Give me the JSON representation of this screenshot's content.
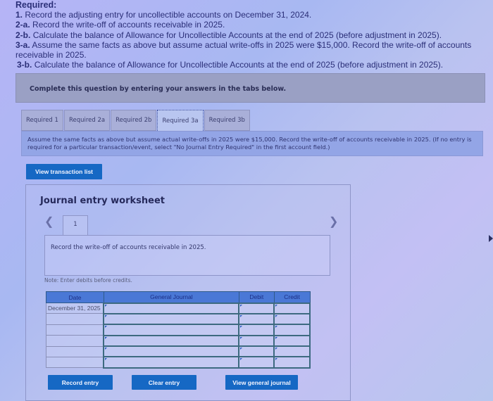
{
  "requirements": {
    "title": "Required:",
    "items": [
      {
        "label": "1.",
        "text": "Record the adjusting entry for uncollectible accounts on December 31, 2024."
      },
      {
        "label": "2-a.",
        "text": "Record the write-off of accounts receivable in 2025."
      },
      {
        "label": "2-b.",
        "text": "Calculate the balance of Allowance for Uncollectible Accounts at the end of 2025 (before adjustment in 2025)."
      },
      {
        "label": "3-a.",
        "text": "Assume the same facts as above but assume actual write-offs in 2025 were $15,000. Record the write-off of accounts receivable in 2025."
      },
      {
        "label": "3-b.",
        "text": "Calculate the balance of Allowance for Uncollectible Accounts at the end of 2025 (before adjustment in 2025)."
      }
    ]
  },
  "instruction": "Complete this question by entering your answers in the tabs below.",
  "tabs": [
    {
      "label": "Required 1",
      "active": false
    },
    {
      "label": "Required 2a",
      "active": false
    },
    {
      "label": "Required 2b",
      "active": false
    },
    {
      "label": "Required 3a",
      "active": true
    },
    {
      "label": "Required 3b",
      "active": false
    }
  ],
  "tab_panel_text": "Assume the same facts as above but assume actual write-offs in 2025 were $15,000. Record the write-off of accounts receivable in 2025. (If no entry is required for a particular transaction/event, select \"No Journal Entry Required\" in the first account field.)",
  "view_transaction_list_label": "View transaction list",
  "worksheet": {
    "title": "Journal entry worksheet",
    "prev_icon": "chevron-left-icon",
    "next_icon": "chevron-right-icon",
    "step_tab": "1",
    "description": "Record the write-off of accounts receivable in 2025.",
    "note": "Note: Enter debits before credits.",
    "table": {
      "headers": [
        "Date",
        "General Journal",
        "Debit",
        "Credit"
      ],
      "rows": [
        {
          "date": "December 31, 2025",
          "account": "",
          "debit": "",
          "credit": ""
        },
        {
          "date": "",
          "account": "",
          "debit": "",
          "credit": ""
        },
        {
          "date": "",
          "account": "",
          "debit": "",
          "credit": ""
        },
        {
          "date": "",
          "account": "",
          "debit": "",
          "credit": ""
        },
        {
          "date": "",
          "account": "",
          "debit": "",
          "credit": ""
        },
        {
          "date": "",
          "account": "",
          "debit": "",
          "credit": ""
        }
      ]
    },
    "buttons": {
      "record": "Record entry",
      "clear": "Clear entry",
      "view_general": "View general journal"
    }
  },
  "colors": {
    "button_blue": "#1668c4",
    "table_header": "#4a78d6",
    "text": "#2b2f78"
  }
}
